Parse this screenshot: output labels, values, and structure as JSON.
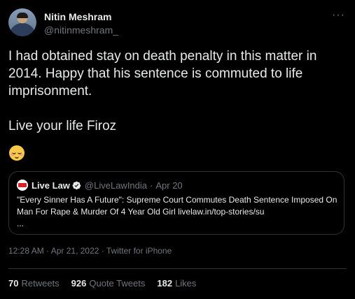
{
  "author": {
    "display_name": "Nitin Meshram",
    "handle": "@nitinmeshram_",
    "avatar_icon": "profile-photo"
  },
  "more_label": "···",
  "tweet": {
    "text": "I had obtained stay on death penalty in this matter in 2014. Happy that his sentence is commuted to life imprisonment.\n\nLive your life Firoz",
    "emoji": "smiling-face-with-blush-emoji"
  },
  "quoted_tweet": {
    "display_name": "Live Law",
    "handle": "@LiveLawIndia",
    "separator": "·",
    "date": "Apr 20",
    "text": "\"Every Sinner Has A Future\": Supreme Court Commutes Death Sentence Imposed On Man For Rape & Murder Of 4 Year Old Girl livelaw.in/top-stories/su\n...",
    "logo_icon": "livelaw-logo",
    "verified_icon": "verified-badge-icon"
  },
  "meta": {
    "time": "12:28 AM",
    "separator": " · ",
    "date": "Apr 21, 2022",
    "client": "Twitter for iPhone"
  },
  "stats": {
    "retweets_count": "70",
    "retweets_label": "Retweets",
    "quote_tweets_count": "926",
    "quote_tweets_label": "Quote Tweets",
    "likes_count": "182",
    "likes_label": "Likes"
  },
  "colors": {
    "background": "#000000",
    "primary_text": "#e7e9ea",
    "secondary_text": "#71767b",
    "border": "#2f3336",
    "verified": "#1d9bf0"
  }
}
